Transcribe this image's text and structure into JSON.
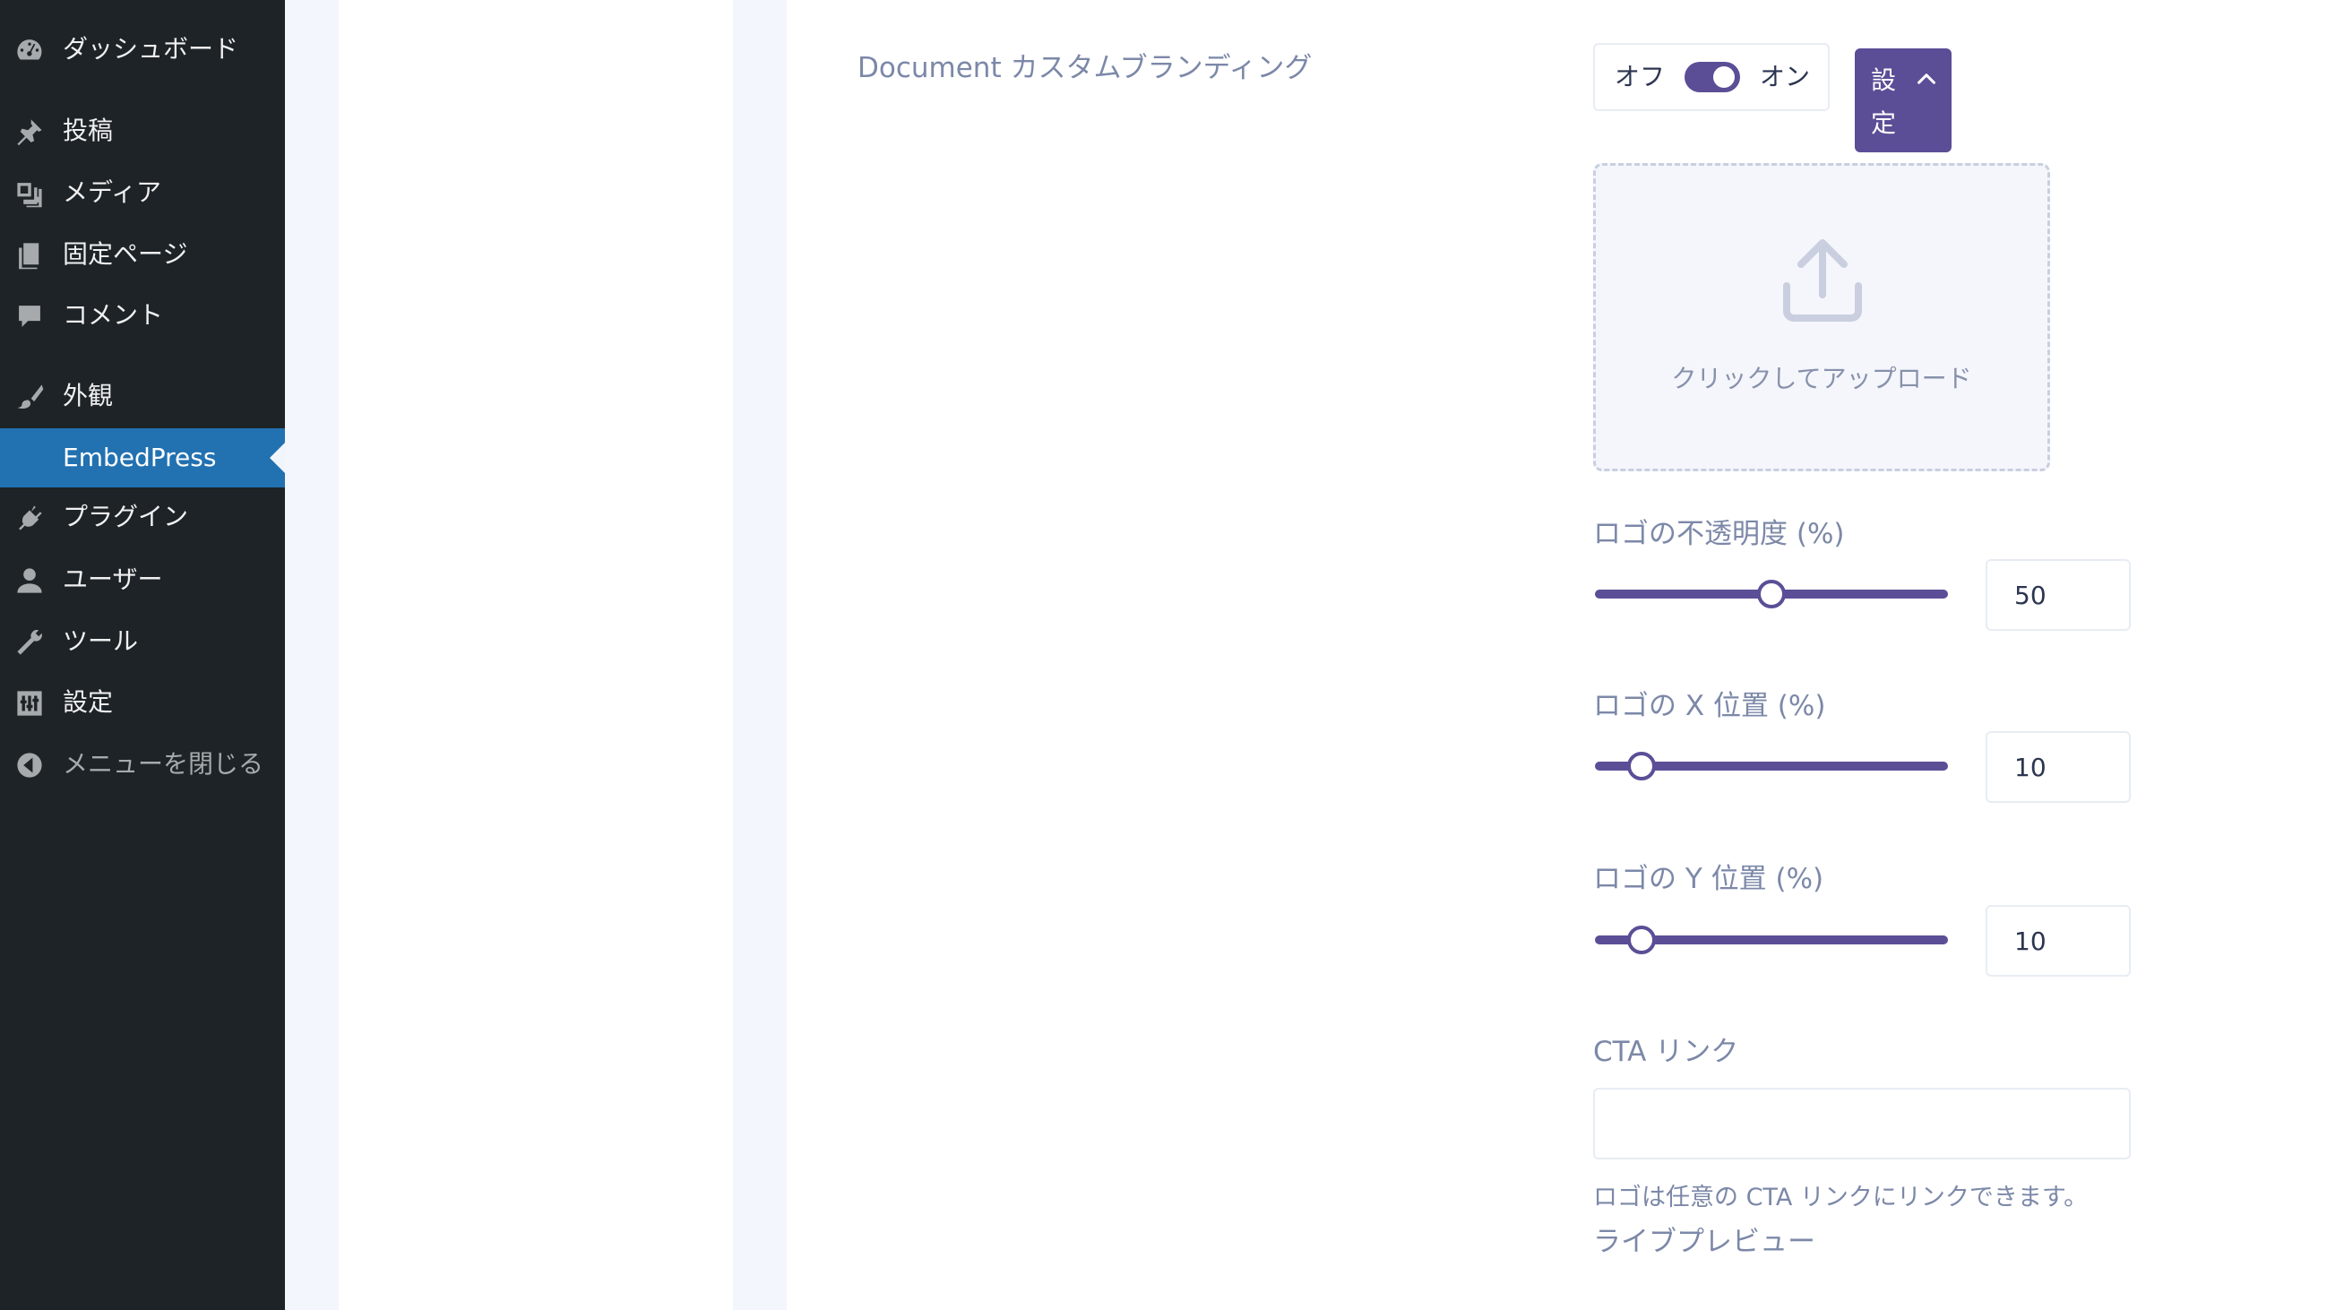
{
  "sidebar": {
    "items": [
      {
        "label": "ダッシュボード",
        "icon": "dashboard-icon"
      },
      {
        "label": "投稿",
        "icon": "pushpin-icon"
      },
      {
        "label": "メディア",
        "icon": "media-icon"
      },
      {
        "label": "固定ページ",
        "icon": "pages-icon"
      },
      {
        "label": "コメント",
        "icon": "comment-icon"
      },
      {
        "label": "外観",
        "icon": "brush-icon"
      },
      {
        "label": "EmbedPress",
        "icon": ""
      },
      {
        "label": "プラグイン",
        "icon": "plugin-icon"
      },
      {
        "label": "ユーザー",
        "icon": "user-icon"
      },
      {
        "label": "ツール",
        "icon": "wrench-icon"
      },
      {
        "label": "設定",
        "icon": "settings-sliders-icon"
      },
      {
        "label": "メニューを閉じる",
        "icon": "collapse-arrow-icon"
      }
    ],
    "colors": {
      "background": "#1d2327",
      "current": "#2271b1"
    }
  },
  "branding": {
    "title": "Document カスタムブランディング",
    "toggle": {
      "off_label": "オフ",
      "on_label": "オン",
      "state": "on"
    },
    "settings_button": "設定",
    "upload_text": "クリックしてアップロード",
    "opacity": {
      "label": "ロゴの不透明度 (%)",
      "value": "50",
      "fraction": 0.5
    },
    "x_pos": {
      "label": "ロゴの X 位置 (%)",
      "value": "10",
      "fraction": 0.1
    },
    "y_pos": {
      "label": "ロゴの Y 位置 (%)",
      "value": "10",
      "fraction": 0.1
    },
    "cta": {
      "label": "CTA リンク",
      "value": "",
      "help": "ロゴは任意の CTA リンクにリンクできます。"
    },
    "live_preview": "ライブプレビュー",
    "accent": "#5b4e96"
  }
}
